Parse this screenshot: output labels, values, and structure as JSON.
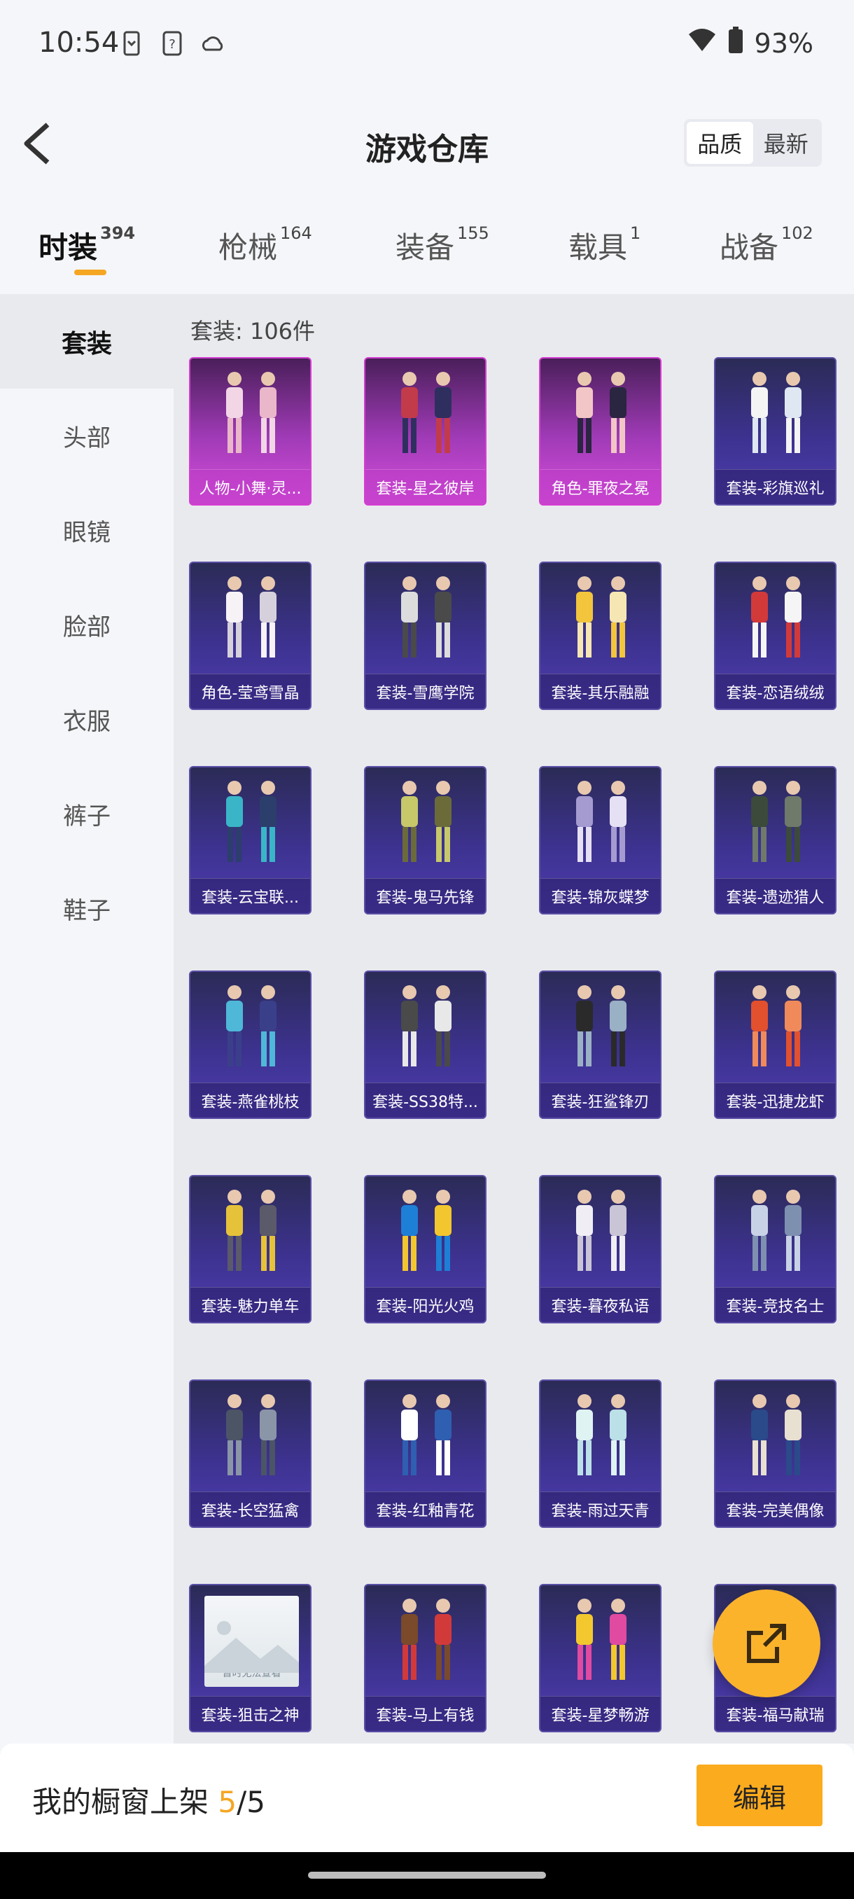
{
  "status_bar": {
    "time": "10:54",
    "battery": "93%"
  },
  "header": {
    "title": "游戏仓库",
    "sort_options": [
      "品质",
      "最新"
    ],
    "active_sort": "品质"
  },
  "tabs": [
    {
      "label": "时装",
      "count": "394"
    },
    {
      "label": "枪械",
      "count": "164"
    },
    {
      "label": "装备",
      "count": "155"
    },
    {
      "label": "载具",
      "count": "1"
    },
    {
      "label": "战备",
      "count": "102"
    }
  ],
  "sidebar": {
    "items": [
      "套装",
      "头部",
      "眼镜",
      "脸部",
      "衣服",
      "裤子",
      "鞋子"
    ]
  },
  "content": {
    "count_label": "套装: 106件",
    "items": [
      {
        "name": "人物-小舞·灵...",
        "rarity": "legend"
      },
      {
        "name": "套装-星之彼岸",
        "rarity": "legend"
      },
      {
        "name": "角色-罪夜之冕",
        "rarity": "legend"
      },
      {
        "name": "套装-彩旗巡礼",
        "rarity": "epic"
      },
      {
        "name": "角色-莹鸢雪晶",
        "rarity": "epic"
      },
      {
        "name": "套装-雪鹰学院",
        "rarity": "epic"
      },
      {
        "name": "套装-其乐融融",
        "rarity": "epic"
      },
      {
        "name": "套装-恋语绒绒",
        "rarity": "epic"
      },
      {
        "name": "套装-云宝联...",
        "rarity": "epic"
      },
      {
        "name": "套装-鬼马先锋",
        "rarity": "epic"
      },
      {
        "name": "套装-锦灰蝶梦",
        "rarity": "epic"
      },
      {
        "name": "套装-遗迹猎人",
        "rarity": "epic"
      },
      {
        "name": "套装-燕雀桃枝",
        "rarity": "epic"
      },
      {
        "name": "套装-SS38特...",
        "rarity": "epic"
      },
      {
        "name": "套装-狂鲨锋刃",
        "rarity": "epic"
      },
      {
        "name": "套装-迅捷龙虾",
        "rarity": "epic"
      },
      {
        "name": "套装-魅力单车",
        "rarity": "epic"
      },
      {
        "name": "套装-阳光火鸡",
        "rarity": "epic"
      },
      {
        "name": "套装-暮夜私语",
        "rarity": "epic"
      },
      {
        "name": "套装-竞技名士",
        "rarity": "epic"
      },
      {
        "name": "套装-长空猛禽",
        "rarity": "epic"
      },
      {
        "name": "套装-红釉青花",
        "rarity": "epic"
      },
      {
        "name": "套装-雨过天青",
        "rarity": "epic"
      },
      {
        "name": "套装-完美偶像",
        "rarity": "epic"
      },
      {
        "name": "套装-狙击之神",
        "rarity": "epic",
        "placeholder": "暂时无法查看"
      },
      {
        "name": "套装-马上有钱",
        "rarity": "epic"
      },
      {
        "name": "套装-星梦畅游",
        "rarity": "epic"
      },
      {
        "name": "套装-福马献瑞",
        "rarity": "epic"
      }
    ]
  },
  "bottom_bar": {
    "prefix": "我的橱窗上架 ",
    "current": "5",
    "total": "/5",
    "edit_label": "编辑"
  },
  "colors": {
    "accent": "#f5a623",
    "legend": "#d43fd1",
    "epic": "#4e3db0"
  }
}
